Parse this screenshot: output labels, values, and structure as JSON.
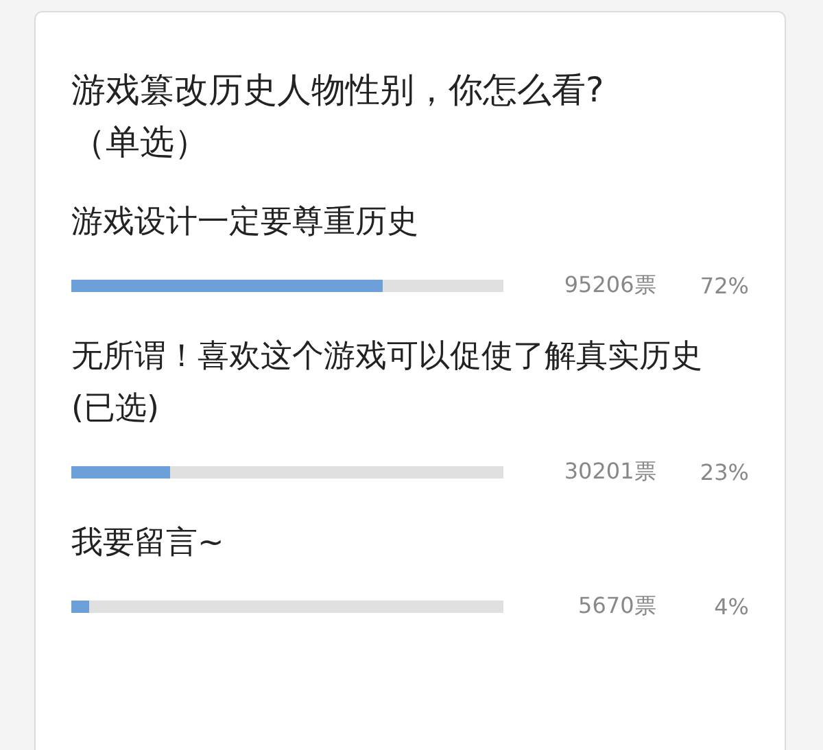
{
  "poll": {
    "question": "游戏篡改历史人物性别，你怎么看?",
    "mode": "（单选）",
    "options": [
      {
        "label": "游戏设计一定要尊重历史",
        "level": 0.72,
        "votes": "95206票",
        "percent": "72%"
      },
      {
        "label": "无所谓！喜欢这个游戏可以促使了解真实历史 (已选)",
        "level": 0.23,
        "votes": "30201票",
        "percent": "23%"
      },
      {
        "label": "我要留言~",
        "level": 0.04,
        "votes": "5670票",
        "percent": "4%"
      }
    ]
  }
}
